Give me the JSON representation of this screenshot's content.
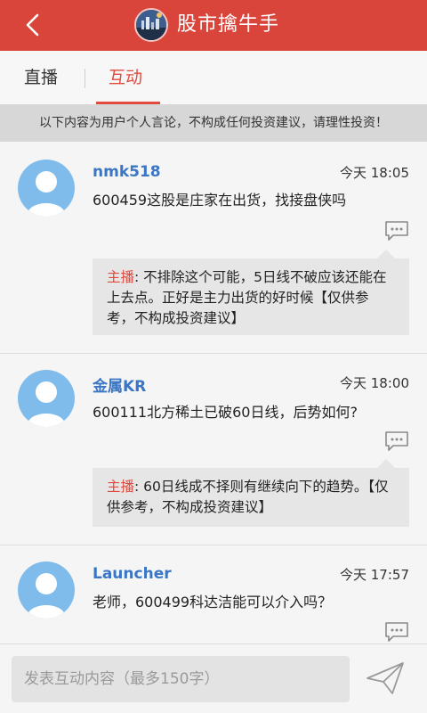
{
  "header": {
    "title": "股市擒牛手",
    "accent": "#d9453b",
    "back_icon": "chevron-left-icon"
  },
  "tabs": [
    {
      "label": "直播",
      "active": false
    },
    {
      "label": "互动",
      "active": true
    }
  ],
  "notice": "以下内容为用户个人言论，不构成任何投资建议，请理性投资！",
  "messages": [
    {
      "user": "nmk518",
      "time": "今天 18:05",
      "content": "600459这股是庄家在出货，找接盘侠吗",
      "reply_label": "主播",
      "reply_sep": ": ",
      "reply_text": "不排除这个可能，5日线不破应该还能在上去点。正好是主力出货的好时候【仅供参考，不构成投资建议】"
    },
    {
      "user": "金属KR",
      "time": "今天 18:00",
      "content": "600111北方稀土已破60日线，后势如何?",
      "reply_label": "主播",
      "reply_sep": ": ",
      "reply_text": "60日线成不择则有继续向下的趋势。【仅供参考，不构成投资建议】"
    },
    {
      "user": "Launcher",
      "time": "今天 17:57",
      "content": "老师，600499科达洁能可以介入吗？"
    }
  ],
  "composer": {
    "placeholder": "发表互动内容（最多150字）",
    "send_icon": "send-icon"
  }
}
